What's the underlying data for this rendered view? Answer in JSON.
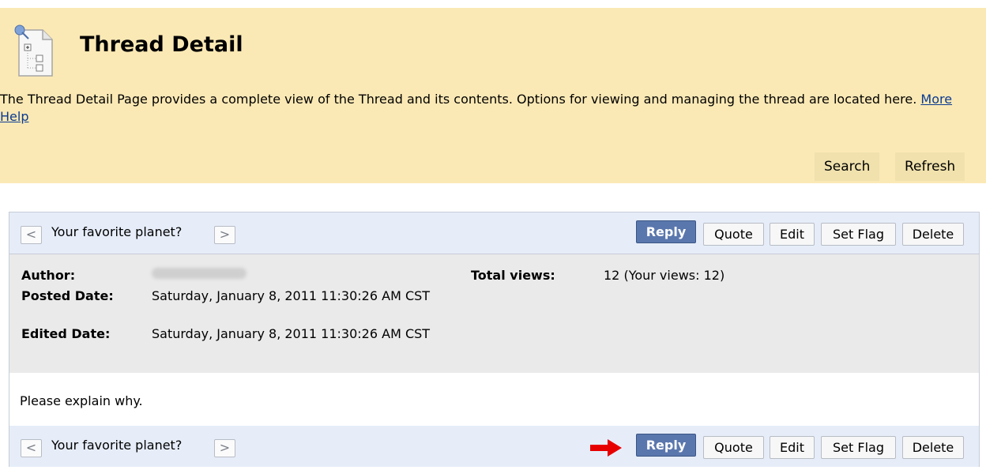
{
  "header": {
    "title": "Thread Detail",
    "description": "The Thread Detail Page provides a complete view of the Thread and its contents. Options for viewing and managing the thread are located here.",
    "more_help": "More Help",
    "search_label": "Search",
    "refresh_label": "Refresh",
    "icon": "thread-detail-page-icon"
  },
  "thread": {
    "name": "Your favorite planet?",
    "prev_glyph": "<",
    "next_glyph": ">",
    "buttons": {
      "reply": "Reply",
      "quote": "Quote",
      "edit": "Edit",
      "set_flag": "Set Flag",
      "delete": "Delete"
    },
    "meta": {
      "author_label": "Author:",
      "posted_label": "Posted Date:",
      "posted_value": "Saturday, January 8, 2011 11:30:26 AM CST",
      "edited_label": "Edited Date:",
      "edited_value": "Saturday, January 8, 2011 11:30:26 AM CST",
      "total_views_label": "Total views:",
      "total_views_value": "12 (Your views: 12)"
    },
    "message": "Please explain why."
  },
  "colors": {
    "header_bg": "#fbe9b5",
    "bar_bg": "#e6edf9",
    "meta_bg": "#eaeaea",
    "reply_button": "#5a77ad",
    "arrow": "#e60000"
  }
}
